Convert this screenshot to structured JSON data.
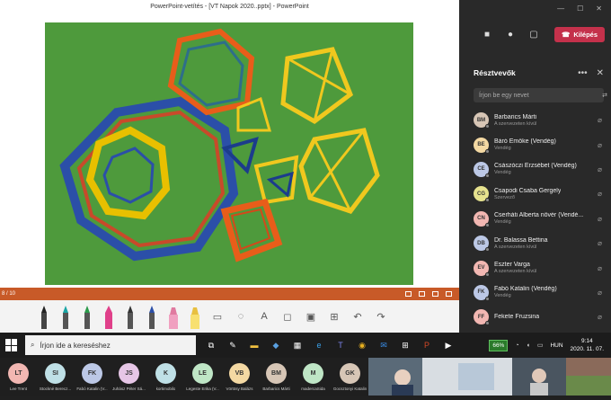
{
  "ppt": {
    "title": "PowerPoint-vetítés - [VT Napok 2020..pptx] - PowerPoint",
    "slide_counter": "8 / 10"
  },
  "teams": {
    "leave_label": "Kilépés",
    "panel_title": "Résztvevők",
    "search_placeholder": "Írjon be egy nevet",
    "participants": [
      {
        "initials": "BM",
        "name": "Barbarics Márti",
        "role": "A szervezeten kívül",
        "color": "#d7c6b6"
      },
      {
        "initials": "BE",
        "name": "Báró Emőke (Vendég)",
        "role": "Vendég",
        "color": "#f4d9a3"
      },
      {
        "initials": "CE",
        "name": "Császóczi Erzsébet (Vendég)",
        "role": "Vendég",
        "color": "#bcc8e6"
      },
      {
        "initials": "CG",
        "name": "Csapodi Csaba Gergely",
        "role": "Szervező",
        "color": "#e6e28e"
      },
      {
        "initials": "CN",
        "name": "Cserháti Alberta nővér (Vendé...",
        "role": "Vendég",
        "color": "#f2b7b2"
      },
      {
        "initials": "DB",
        "name": "Dr. Balassa Bettina",
        "role": "A szervezeten kívül",
        "color": "#bcc8e6"
      },
      {
        "initials": "EV",
        "name": "Eszter Varga",
        "role": "A szervezeten kívül",
        "color": "#f2b7b2"
      },
      {
        "initials": "FK",
        "name": "Fabó Katalin (Vendég)",
        "role": "Vendég",
        "color": "#bcc8e6"
      },
      {
        "initials": "FF",
        "name": "Fekete Fruzsina",
        "role": "",
        "color": "#f2b7b2"
      }
    ]
  },
  "taskbar": {
    "search_placeholder": "Írjon ide a kereséshez",
    "battery": "66%",
    "language": "HUN",
    "time": "9:14",
    "date": "2020. 11. 07."
  },
  "video_strip": [
    {
      "initials": "LT",
      "name": "Lee Trent",
      "color": "#f2b7b2"
    },
    {
      "initials": "SI",
      "name": "Stockné Berecz...",
      "color": "#bfe0e6"
    },
    {
      "initials": "FK",
      "name": "Fabó Katalin (V...",
      "color": "#bcc8e6"
    },
    {
      "initials": "JS",
      "name": "Juhász Péter Sá...",
      "color": "#e6c6e6"
    },
    {
      "initials": "K",
      "name": "kortimobilo",
      "color": "#bfe0e6"
    },
    {
      "initials": "LE",
      "name": "Legeste Erika (V...",
      "color": "#bfe6c6"
    },
    {
      "initials": "VB",
      "name": "Vörtösy Balázs",
      "color": "#f4d9a3"
    },
    {
      "initials": "BM",
      "name": "Barbarics Márti",
      "color": "#d7c6b6"
    },
    {
      "initials": "M",
      "name": "madercaSida",
      "color": "#bfe6c6"
    },
    {
      "initials": "GK",
      "name": "Gocsztonyi Katalin",
      "color": "#d7c6b6"
    }
  ]
}
